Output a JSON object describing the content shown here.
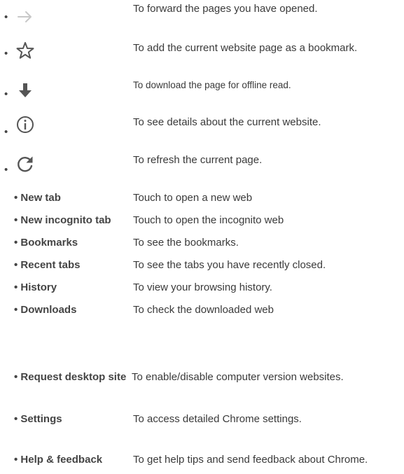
{
  "icon_rows": [
    {
      "icon": "forward-arrow-icon",
      "text": "To forward the pages you have opened."
    },
    {
      "icon": "star-icon",
      "text": "To add the current website page as a bookmark."
    },
    {
      "icon": "download-arrow-icon",
      "text": "To download the page for offline read."
    },
    {
      "icon": "info-icon",
      "text": "To see details about the current website."
    },
    {
      "icon": "refresh-icon",
      "text": "To refresh the current page."
    }
  ],
  "menu_rows": [
    {
      "label": "New tab",
      "text": "Touch to open a new web"
    },
    {
      "label": "New incognito tab",
      "text": "Touch to open the incognito web"
    },
    {
      "label": "Bookmarks",
      "text": "To see the bookmarks."
    },
    {
      "label": "Recent tabs",
      "text": "To see the tabs you have recently closed."
    },
    {
      "label": "History",
      "text": "To view your browsing history."
    },
    {
      "label": "Downloads",
      "text": "To check the downloaded web"
    },
    {
      "label": "Request desktop site",
      "text": "To enable/disable computer version websites."
    },
    {
      "label": "Settings",
      "text": "To access detailed Chrome settings."
    },
    {
      "label": "Help & feedback",
      "text": "To get help tips and send feedback about Chrome."
    }
  ],
  "bullet": "•",
  "colors": {
    "text": "#3a3a3a",
    "icon_light": "#c8c8c8",
    "icon_dark": "#555555"
  }
}
